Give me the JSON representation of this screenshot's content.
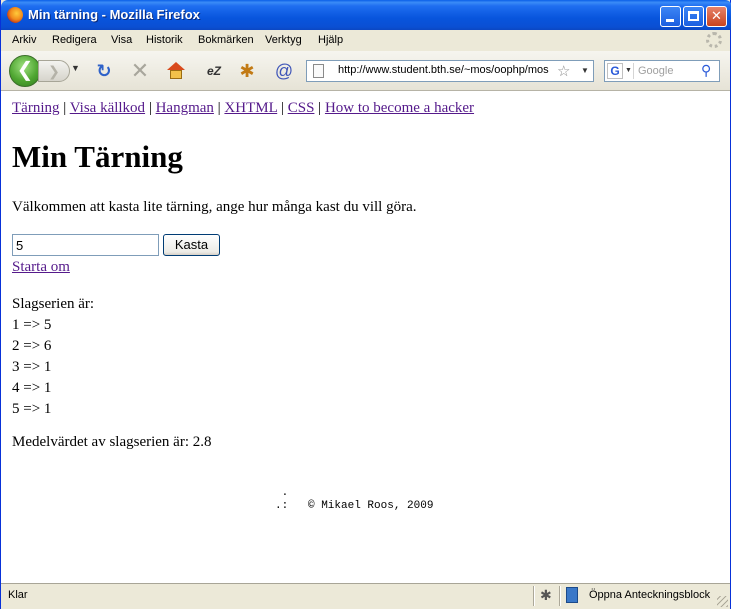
{
  "window": {
    "title": "Min tärning - Mozilla Firefox",
    "buttons": {
      "minimize": "",
      "maximize": "",
      "close": "✕"
    }
  },
  "menubar": {
    "items": [
      "Arkiv",
      "Redigera",
      "Visa",
      "Historik",
      "Bokmärken",
      "Verktyg",
      "Hjälp"
    ]
  },
  "toolbar": {
    "back_glyph": "❮",
    "forward_glyph": "❯",
    "url": "http://www.student.bth.se/~mos/oophp/mos",
    "search_placeholder": "Google",
    "search_engine_glyph": "G"
  },
  "page": {
    "nav_links": [
      "Tärning",
      "Visa källkod",
      "Hangman",
      "XHTML",
      "CSS",
      "How to become a hacker"
    ],
    "nav_separator": " | ",
    "title": "Min Tärning",
    "intro": "Välkommen att kasta lite tärning, ange hur många kast du vill göra.",
    "input_value": "5",
    "throw_button": "Kasta",
    "restart_link": "Starta om",
    "series_heading": "Slagserien är:",
    "rolls": [
      "1 => 5",
      "2 => 6",
      "3 => 1",
      "4 => 1",
      "5 => 1"
    ],
    "average": "Medelvärdet av slagserien är: 2.8",
    "footer_line1": " .",
    "footer_line2": ".:   © Mikael Roos, 2009"
  },
  "statusbar": {
    "status": "Klar",
    "addon_label": "Öppna Anteckningsblock"
  },
  "colors": {
    "titlebar": "#0855dd",
    "visited_link": "#551a8b"
  }
}
